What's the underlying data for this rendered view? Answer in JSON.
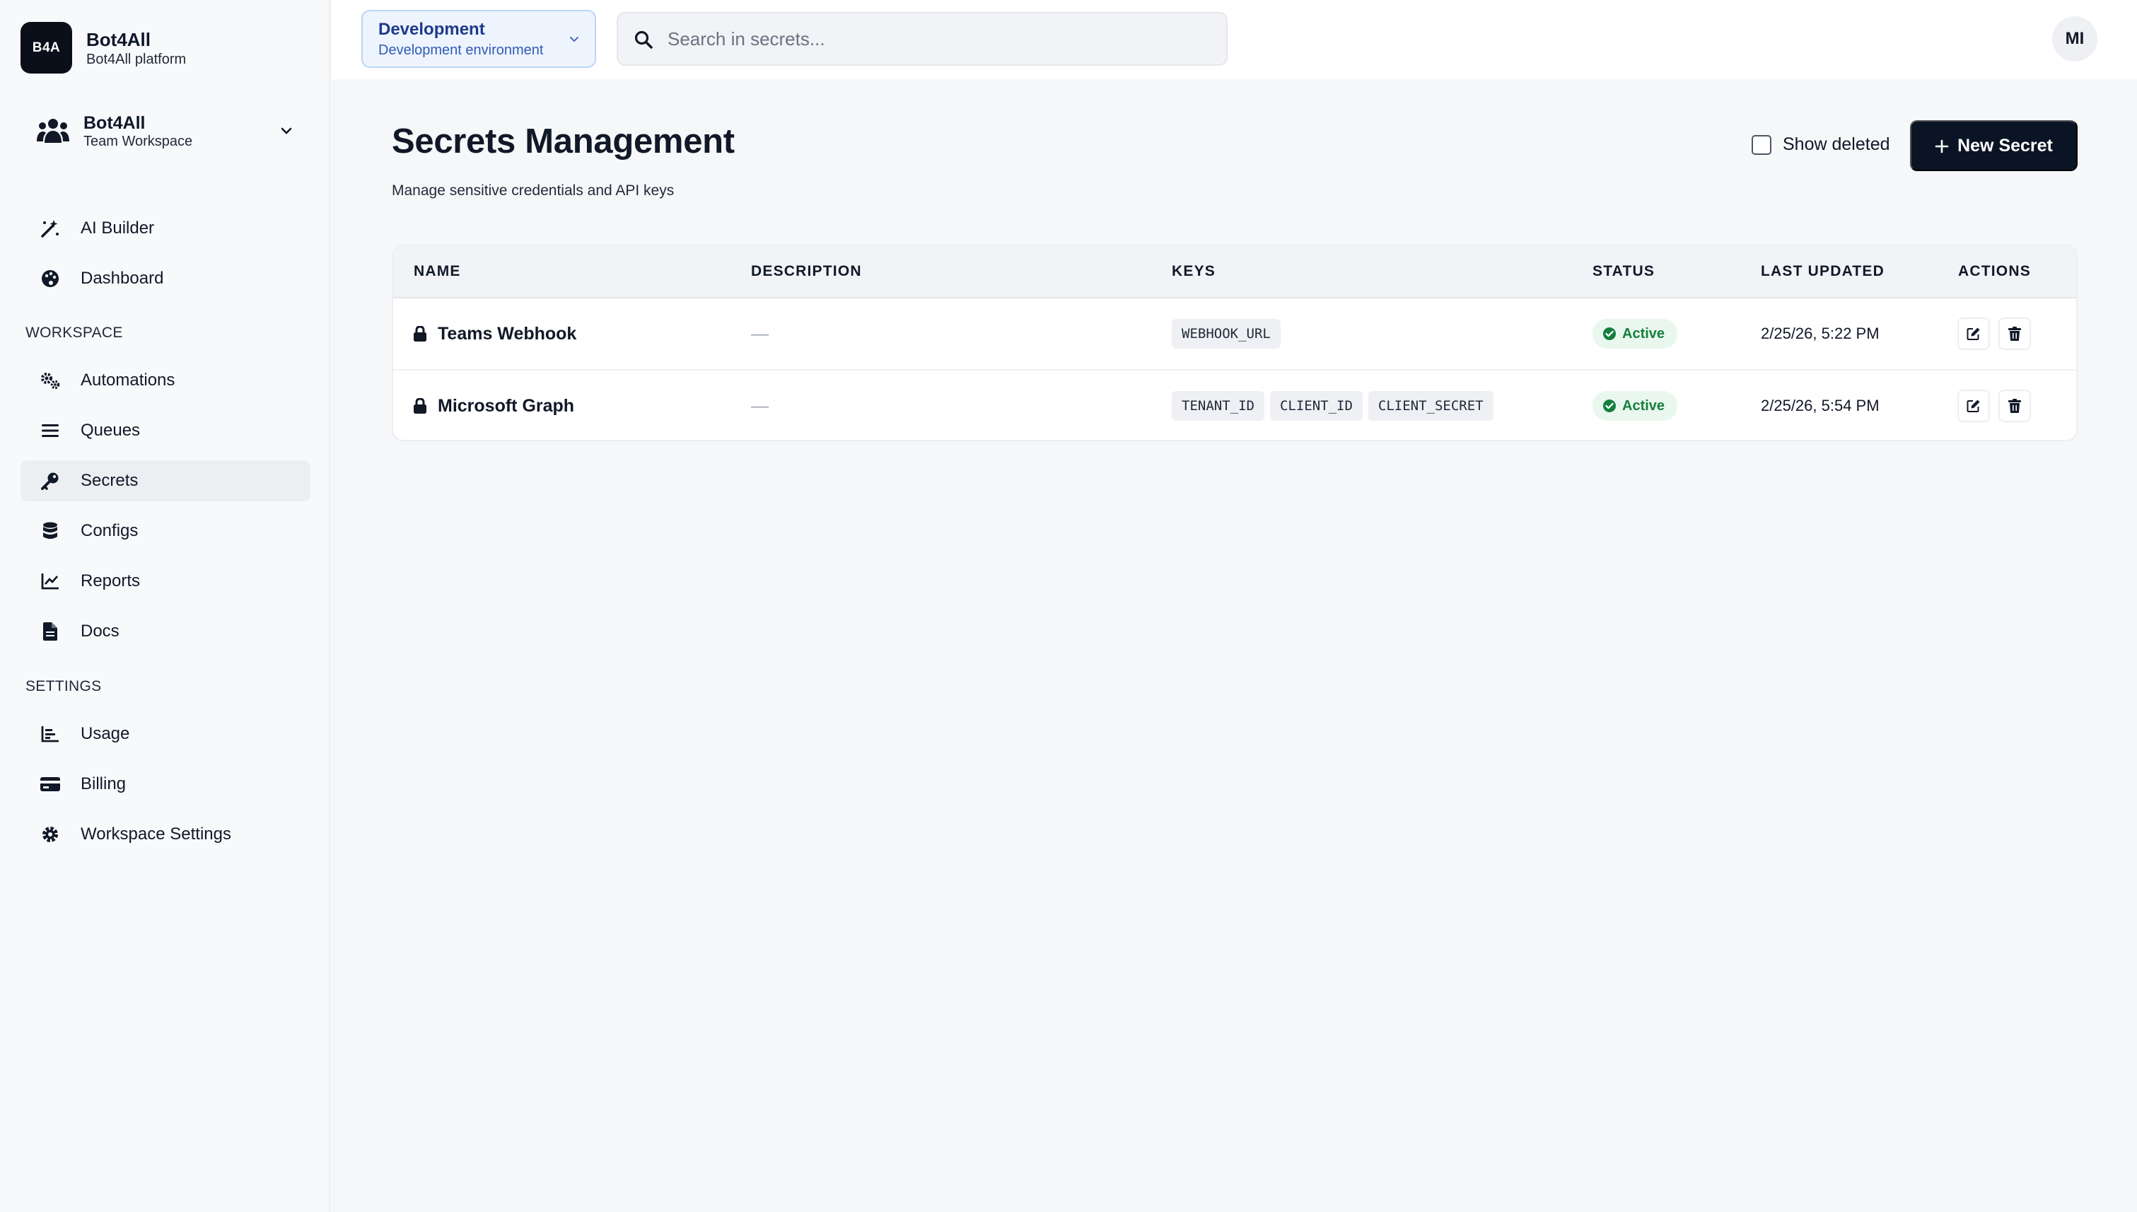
{
  "brand": {
    "logo_text": "B4A",
    "name": "Bot4All",
    "subtitle": "Bot4All platform"
  },
  "team": {
    "name": "Bot4All",
    "subtitle": "Team Workspace"
  },
  "nav": {
    "primary": [
      {
        "label": "AI Builder",
        "icon": "magic-wand-icon"
      },
      {
        "label": "Dashboard",
        "icon": "palette-icon"
      }
    ],
    "workspace_label": "WORKSPACE",
    "workspace": [
      {
        "label": "Automations",
        "icon": "cogs-icon"
      },
      {
        "label": "Queues",
        "icon": "list-icon"
      },
      {
        "label": "Secrets",
        "icon": "key-icon",
        "active": true
      },
      {
        "label": "Configs",
        "icon": "database-icon"
      },
      {
        "label": "Reports",
        "icon": "chart-line-icon"
      },
      {
        "label": "Docs",
        "icon": "file-icon"
      }
    ],
    "settings_label": "SETTINGS",
    "settings": [
      {
        "label": "Usage",
        "icon": "bar-chart-icon"
      },
      {
        "label": "Billing",
        "icon": "credit-card-icon"
      },
      {
        "label": "Workspace Settings",
        "icon": "gear-icon"
      }
    ]
  },
  "topbar": {
    "env_title": "Development",
    "env_subtitle": "Development environment",
    "search_placeholder": "Search in secrets...",
    "search_value": "",
    "avatar_initials": "MI"
  },
  "page": {
    "title": "Secrets Management",
    "subtitle": "Manage sensitive credentials and API keys",
    "show_deleted_label": "Show deleted",
    "show_deleted_checked": false,
    "new_button_label": "New Secret"
  },
  "table": {
    "headers": [
      "NAME",
      "DESCRIPTION",
      "KEYS",
      "STATUS",
      "LAST UPDATED",
      "ACTIONS"
    ],
    "rows": [
      {
        "name": "Teams Webhook",
        "description": "—",
        "keys": [
          "WEBHOOK_URL"
        ],
        "status": "Active",
        "last_updated": "2/25/26, 5:22 PM"
      },
      {
        "name": "Microsoft Graph",
        "description": "—",
        "keys": [
          "TENANT_ID",
          "CLIENT_ID",
          "CLIENT_SECRET"
        ],
        "status": "Active",
        "last_updated": "2/25/26, 5:54 PM"
      }
    ]
  },
  "colors": {
    "accent_dark": "#0b1424",
    "env_blue": "#1e3a8a",
    "status_green": "#15803d",
    "status_bg": "#e9f7ee"
  }
}
